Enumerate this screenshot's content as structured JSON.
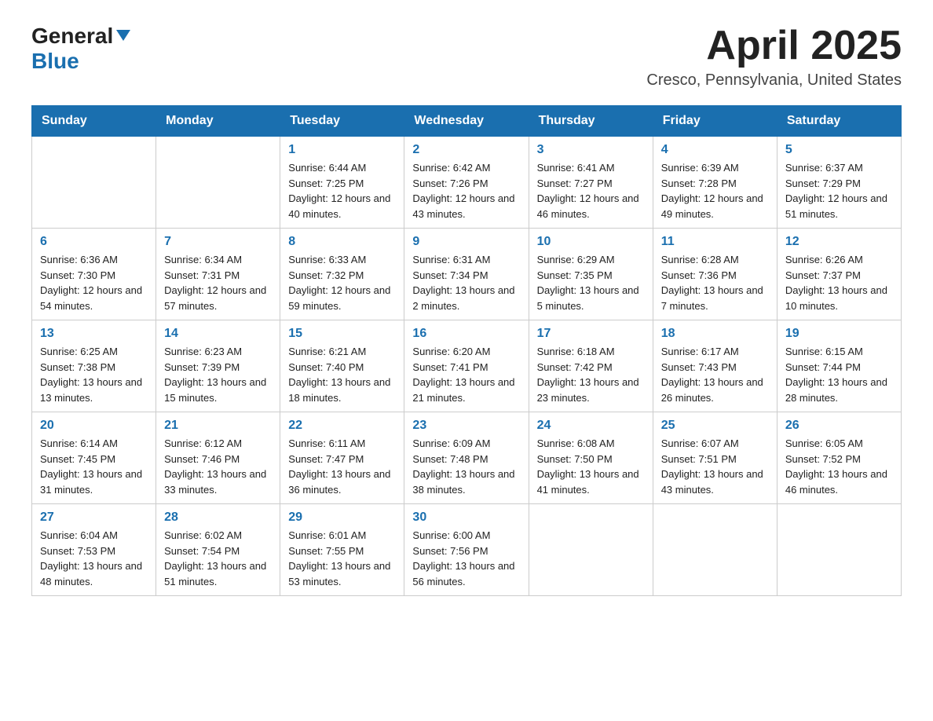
{
  "header": {
    "logo_general": "General",
    "logo_blue": "Blue",
    "title": "April 2025",
    "location": "Cresco, Pennsylvania, United States"
  },
  "days_of_week": [
    "Sunday",
    "Monday",
    "Tuesday",
    "Wednesday",
    "Thursday",
    "Friday",
    "Saturday"
  ],
  "weeks": [
    [
      {
        "day": "",
        "sunrise": "",
        "sunset": "",
        "daylight": ""
      },
      {
        "day": "",
        "sunrise": "",
        "sunset": "",
        "daylight": ""
      },
      {
        "day": "1",
        "sunrise": "Sunrise: 6:44 AM",
        "sunset": "Sunset: 7:25 PM",
        "daylight": "Daylight: 12 hours and 40 minutes."
      },
      {
        "day": "2",
        "sunrise": "Sunrise: 6:42 AM",
        "sunset": "Sunset: 7:26 PM",
        "daylight": "Daylight: 12 hours and 43 minutes."
      },
      {
        "day": "3",
        "sunrise": "Sunrise: 6:41 AM",
        "sunset": "Sunset: 7:27 PM",
        "daylight": "Daylight: 12 hours and 46 minutes."
      },
      {
        "day": "4",
        "sunrise": "Sunrise: 6:39 AM",
        "sunset": "Sunset: 7:28 PM",
        "daylight": "Daylight: 12 hours and 49 minutes."
      },
      {
        "day": "5",
        "sunrise": "Sunrise: 6:37 AM",
        "sunset": "Sunset: 7:29 PM",
        "daylight": "Daylight: 12 hours and 51 minutes."
      }
    ],
    [
      {
        "day": "6",
        "sunrise": "Sunrise: 6:36 AM",
        "sunset": "Sunset: 7:30 PM",
        "daylight": "Daylight: 12 hours and 54 minutes."
      },
      {
        "day": "7",
        "sunrise": "Sunrise: 6:34 AM",
        "sunset": "Sunset: 7:31 PM",
        "daylight": "Daylight: 12 hours and 57 minutes."
      },
      {
        "day": "8",
        "sunrise": "Sunrise: 6:33 AM",
        "sunset": "Sunset: 7:32 PM",
        "daylight": "Daylight: 12 hours and 59 minutes."
      },
      {
        "day": "9",
        "sunrise": "Sunrise: 6:31 AM",
        "sunset": "Sunset: 7:34 PM",
        "daylight": "Daylight: 13 hours and 2 minutes."
      },
      {
        "day": "10",
        "sunrise": "Sunrise: 6:29 AM",
        "sunset": "Sunset: 7:35 PM",
        "daylight": "Daylight: 13 hours and 5 minutes."
      },
      {
        "day": "11",
        "sunrise": "Sunrise: 6:28 AM",
        "sunset": "Sunset: 7:36 PM",
        "daylight": "Daylight: 13 hours and 7 minutes."
      },
      {
        "day": "12",
        "sunrise": "Sunrise: 6:26 AM",
        "sunset": "Sunset: 7:37 PM",
        "daylight": "Daylight: 13 hours and 10 minutes."
      }
    ],
    [
      {
        "day": "13",
        "sunrise": "Sunrise: 6:25 AM",
        "sunset": "Sunset: 7:38 PM",
        "daylight": "Daylight: 13 hours and 13 minutes."
      },
      {
        "day": "14",
        "sunrise": "Sunrise: 6:23 AM",
        "sunset": "Sunset: 7:39 PM",
        "daylight": "Daylight: 13 hours and 15 minutes."
      },
      {
        "day": "15",
        "sunrise": "Sunrise: 6:21 AM",
        "sunset": "Sunset: 7:40 PM",
        "daylight": "Daylight: 13 hours and 18 minutes."
      },
      {
        "day": "16",
        "sunrise": "Sunrise: 6:20 AM",
        "sunset": "Sunset: 7:41 PM",
        "daylight": "Daylight: 13 hours and 21 minutes."
      },
      {
        "day": "17",
        "sunrise": "Sunrise: 6:18 AM",
        "sunset": "Sunset: 7:42 PM",
        "daylight": "Daylight: 13 hours and 23 minutes."
      },
      {
        "day": "18",
        "sunrise": "Sunrise: 6:17 AM",
        "sunset": "Sunset: 7:43 PM",
        "daylight": "Daylight: 13 hours and 26 minutes."
      },
      {
        "day": "19",
        "sunrise": "Sunrise: 6:15 AM",
        "sunset": "Sunset: 7:44 PM",
        "daylight": "Daylight: 13 hours and 28 minutes."
      }
    ],
    [
      {
        "day": "20",
        "sunrise": "Sunrise: 6:14 AM",
        "sunset": "Sunset: 7:45 PM",
        "daylight": "Daylight: 13 hours and 31 minutes."
      },
      {
        "day": "21",
        "sunrise": "Sunrise: 6:12 AM",
        "sunset": "Sunset: 7:46 PM",
        "daylight": "Daylight: 13 hours and 33 minutes."
      },
      {
        "day": "22",
        "sunrise": "Sunrise: 6:11 AM",
        "sunset": "Sunset: 7:47 PM",
        "daylight": "Daylight: 13 hours and 36 minutes."
      },
      {
        "day": "23",
        "sunrise": "Sunrise: 6:09 AM",
        "sunset": "Sunset: 7:48 PM",
        "daylight": "Daylight: 13 hours and 38 minutes."
      },
      {
        "day": "24",
        "sunrise": "Sunrise: 6:08 AM",
        "sunset": "Sunset: 7:50 PM",
        "daylight": "Daylight: 13 hours and 41 minutes."
      },
      {
        "day": "25",
        "sunrise": "Sunrise: 6:07 AM",
        "sunset": "Sunset: 7:51 PM",
        "daylight": "Daylight: 13 hours and 43 minutes."
      },
      {
        "day": "26",
        "sunrise": "Sunrise: 6:05 AM",
        "sunset": "Sunset: 7:52 PM",
        "daylight": "Daylight: 13 hours and 46 minutes."
      }
    ],
    [
      {
        "day": "27",
        "sunrise": "Sunrise: 6:04 AM",
        "sunset": "Sunset: 7:53 PM",
        "daylight": "Daylight: 13 hours and 48 minutes."
      },
      {
        "day": "28",
        "sunrise": "Sunrise: 6:02 AM",
        "sunset": "Sunset: 7:54 PM",
        "daylight": "Daylight: 13 hours and 51 minutes."
      },
      {
        "day": "29",
        "sunrise": "Sunrise: 6:01 AM",
        "sunset": "Sunset: 7:55 PM",
        "daylight": "Daylight: 13 hours and 53 minutes."
      },
      {
        "day": "30",
        "sunrise": "Sunrise: 6:00 AM",
        "sunset": "Sunset: 7:56 PM",
        "daylight": "Daylight: 13 hours and 56 minutes."
      },
      {
        "day": "",
        "sunrise": "",
        "sunset": "",
        "daylight": ""
      },
      {
        "day": "",
        "sunrise": "",
        "sunset": "",
        "daylight": ""
      },
      {
        "day": "",
        "sunrise": "",
        "sunset": "",
        "daylight": ""
      }
    ]
  ]
}
